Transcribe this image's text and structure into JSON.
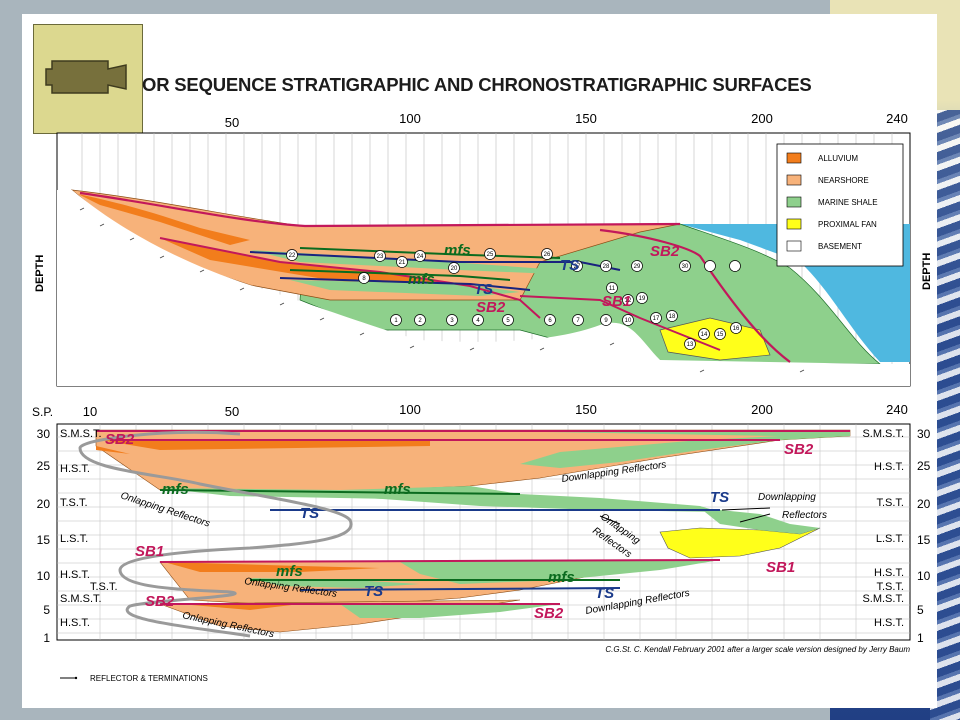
{
  "title": "OR SEQUENCE STRATIGRAPHIC AND CHRONOSTRATIGRAPHIC SURFACES",
  "top_axis_ticks": [
    "50",
    "100",
    "150",
    "200",
    "240"
  ],
  "bottom_axis_ticks": [
    "10",
    "50",
    "100",
    "150",
    "200",
    "240"
  ],
  "sp_label": "S.P.",
  "depth_label": "DEPTH",
  "legend": [
    {
      "label": "ALLUVIUM",
      "color": "#f27d1c"
    },
    {
      "label": "NEARSHORE",
      "color": "#f7b27a"
    },
    {
      "label": "MARINE SHALE",
      "color": "#8ed08c"
    },
    {
      "label": "PROXIMAL FAN",
      "color": "#ffff1a"
    },
    {
      "label": "BASEMENT",
      "color": "#ffffff"
    }
  ],
  "top_labels": {
    "mfs1": "mfs",
    "mfs2": "mfs",
    "ts1": "TS",
    "ts2": "TS",
    "sb2a": "SB2",
    "sb2b": "SB2",
    "sb1": "SB1"
  },
  "top_numbers": [
    "1",
    "2",
    "3",
    "4",
    "5",
    "6",
    "7",
    "8",
    "9",
    "10",
    "11",
    "12",
    "13",
    "14",
    "15",
    "16",
    "17",
    "18",
    "19",
    "20",
    "21",
    "22",
    "23",
    "24",
    "25",
    "26",
    "27",
    "28",
    "29",
    "30"
  ],
  "time_ticks": [
    "30",
    "25",
    "20",
    "15",
    "10",
    "5",
    "1"
  ],
  "systems_tracts": [
    {
      "key": "smst_top",
      "label": "S.M.S.T."
    },
    {
      "key": "hst1",
      "label": "H.S.T."
    },
    {
      "key": "tst1",
      "label": "T.S.T."
    },
    {
      "key": "lst",
      "label": "L.S.T."
    },
    {
      "key": "hst2",
      "label": "H.S.T."
    },
    {
      "key": "tst2",
      "label": "T.S.T."
    },
    {
      "key": "smst2",
      "label": "S.M.S.T."
    },
    {
      "key": "hst3",
      "label": "H.S.T."
    }
  ],
  "bottom_labels": {
    "sb2_tl": "SB2",
    "sb2_tr": "SB2",
    "mfs_l": "mfs",
    "mfs_m": "mfs",
    "ts_l": "TS",
    "ts_r": "TS",
    "sb1_l": "SB1",
    "sb1_r": "SB1",
    "mfs_l2": "mfs",
    "mfs_r2": "mfs",
    "ts_l2": "TS",
    "ts_r2": "TS",
    "sb2_bl": "SB2",
    "sb2_br": "SB2"
  },
  "annotations": {
    "downlapping1": "Downlapping Reflectors",
    "onlapping1": "Onlapping Reflectors",
    "downlapping2_a": "Downlapping",
    "downlapping2_b": "Reflectors",
    "onlapping2_a": "Onlapping",
    "onlapping2_b": "Reflectors",
    "onlapping3": "Onlapping Reflectors",
    "downlapping3": "Downlapping Reflectors",
    "onlapping4": "Onlapping Reflectors"
  },
  "credit": "C.G.St. C. Kendall February 2001 after a larger scale version designed by Jerry Baum",
  "footer_legend": "REFLECTOR & TERMINATIONS"
}
